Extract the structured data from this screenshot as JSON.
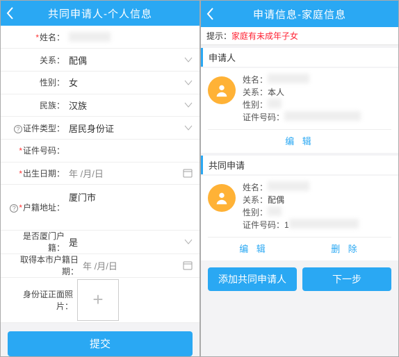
{
  "left": {
    "title": "共同申请人-个人信息",
    "rows": {
      "name_label": "姓名：",
      "relation_label": "关系：",
      "relation_value": "配偶",
      "gender_label": "性别：",
      "gender_value": "女",
      "nation_label": "民族：",
      "nation_value": "汉族",
      "idtype_label": "证件类型：",
      "idtype_value": "居民身份证",
      "idno_label": "证件号码：",
      "birth_label": "出生日期：",
      "birth_value": "年 /月/日",
      "addr_label": "户籍地址：",
      "addr_value": "厦门市",
      "isxm_label": "是否厦门户籍：",
      "isxm_value": "是",
      "gotdate_label": "取得本市户籍日期：",
      "gotdate_value": "年 /月/日",
      "photo_label": "身份证正面照片："
    },
    "submit": "提交"
  },
  "right": {
    "title": "申请信息-家庭信息",
    "tip_prefix": "提示：",
    "tip_text": "家庭有未成年子女",
    "section_applicant": "申请人",
    "section_coapplicant": "共同申请",
    "labels": {
      "name": "姓名：",
      "relation": "关系：",
      "gender": "性别：",
      "idno": "证件号码："
    },
    "applicant": {
      "relation": "本人",
      "idno_masked": ""
    },
    "coapplicant": {
      "relation": "配偶",
      "idno_prefix": "1"
    },
    "edit": "编 辑",
    "delete": "删 除",
    "add_btn": "添加共同申请人",
    "next_btn": "下一步"
  }
}
